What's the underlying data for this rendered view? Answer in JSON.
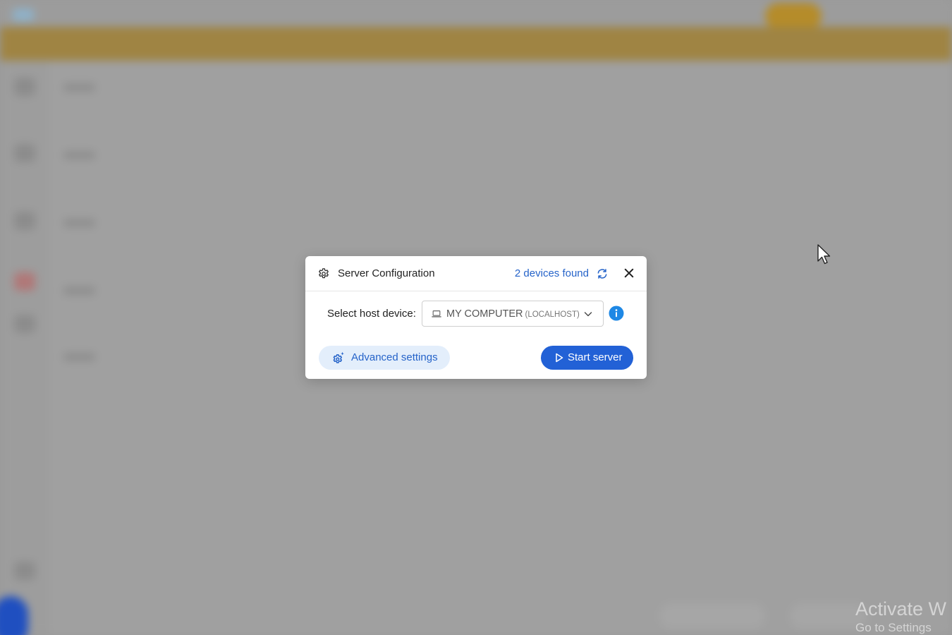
{
  "modal": {
    "title": "Server Configuration",
    "devices_found": "2 devices found",
    "host_label": "Select host device:",
    "selected_device": "MY COMPUTER",
    "selected_device_sub": "(LOCALHOST)",
    "advanced_settings_label": "Advanced settings",
    "start_server_label": "Start server",
    "icons": {
      "title": "gear-icon",
      "refresh": "refresh-icon",
      "close": "close-icon",
      "device": "laptop-icon",
      "dropdown": "chevron-down-icon",
      "info": "info-icon",
      "advanced": "gears-sparkle-icon",
      "start": "play-icon"
    }
  },
  "watermark": {
    "title": "Activate W",
    "subtitle": "Go to Settings"
  },
  "colors": {
    "accent": "#2261d6",
    "link": "#2563c9",
    "overlay": "#9a9a9a",
    "banner": "#9f8443",
    "info": "#1e88e5"
  }
}
